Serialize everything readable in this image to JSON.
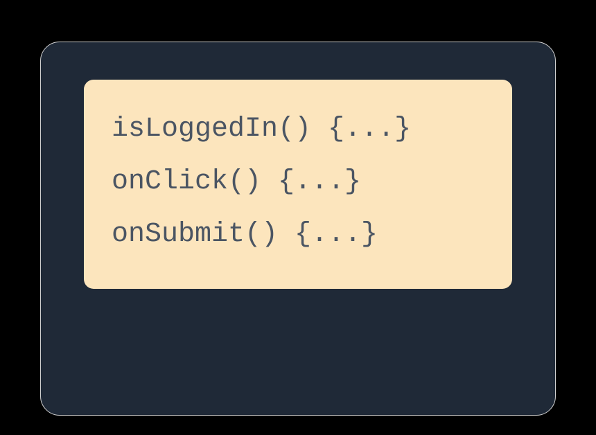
{
  "code": {
    "lines": [
      "isLoggedIn() {...}",
      "onClick() {...}",
      "onSubmit() {...}"
    ]
  },
  "colors": {
    "outer_bg": "#000000",
    "panel_bg": "#1f2937",
    "panel_border": "#d0d0d0",
    "code_bg": "#fce5bd",
    "code_text": "#4b5563"
  }
}
